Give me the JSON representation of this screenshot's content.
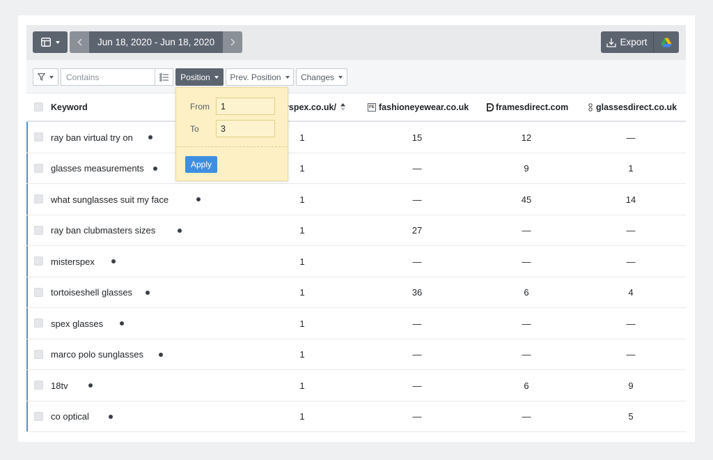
{
  "toolbar": {
    "layout_icon": "table-layout-icon",
    "date_range": "Jun 18, 2020 - Jun 18, 2020",
    "prev_icon": "chevron-left-icon",
    "next_icon": "chevron-right-icon",
    "export_label": "Export",
    "export_icon": "download-icon",
    "drive_icon": "google-drive-icon"
  },
  "filters": {
    "funnel_icon": "funnel-icon",
    "search_placeholder": "Contains",
    "position_label": "Position",
    "prev_position_label": "Prev. Position",
    "changes_label": "Changes"
  },
  "popup": {
    "from_label": "From",
    "from_value": "1",
    "to_label": "To",
    "to_value": "3",
    "apply_label": "Apply"
  },
  "columns": {
    "keyword": "Keyword",
    "col1": "rspex.co.uk/",
    "col2": "fashioneyewear.co.uk",
    "col3": "framesdirect.com",
    "col4": "glassesdirect.co.uk",
    "col2_icon_text": "FE"
  },
  "rows": [
    {
      "keyword": "ray ban virtual try on",
      "v1": "1",
      "v2": "15",
      "v3": "12",
      "v4": "—"
    },
    {
      "keyword": "glasses measurements",
      "v1": "1",
      "v2": "—",
      "v3": "9",
      "v4": "1"
    },
    {
      "keyword": "what sunglasses suit my face",
      "v1": "1",
      "v2": "—",
      "v3": "45",
      "v4": "14"
    },
    {
      "keyword": "ray ban clubmasters sizes",
      "v1": "1",
      "v2": "27",
      "v3": "—",
      "v4": "—"
    },
    {
      "keyword": "misterspex",
      "v1": "1",
      "v2": "—",
      "v3": "—",
      "v4": "—"
    },
    {
      "keyword": "tortoiseshell glasses",
      "v1": "1",
      "v2": "36",
      "v3": "6",
      "v4": "4"
    },
    {
      "keyword": "spex glasses",
      "v1": "1",
      "v2": "—",
      "v3": "—",
      "v4": "—"
    },
    {
      "keyword": "marco polo sunglasses",
      "v1": "1",
      "v2": "—",
      "v3": "—",
      "v4": "—"
    },
    {
      "keyword": "18tv",
      "v1": "1",
      "v2": "—",
      "v3": "6",
      "v4": "9"
    },
    {
      "keyword": "co optical",
      "v1": "1",
      "v2": "—",
      "v3": "—",
      "v4": "5"
    }
  ],
  "colors": {
    "accent": "#3f8fe0",
    "dark_button": "#5c6470",
    "popup_bg": "#fcf0c4",
    "row_marker": "#4a90d9"
  }
}
